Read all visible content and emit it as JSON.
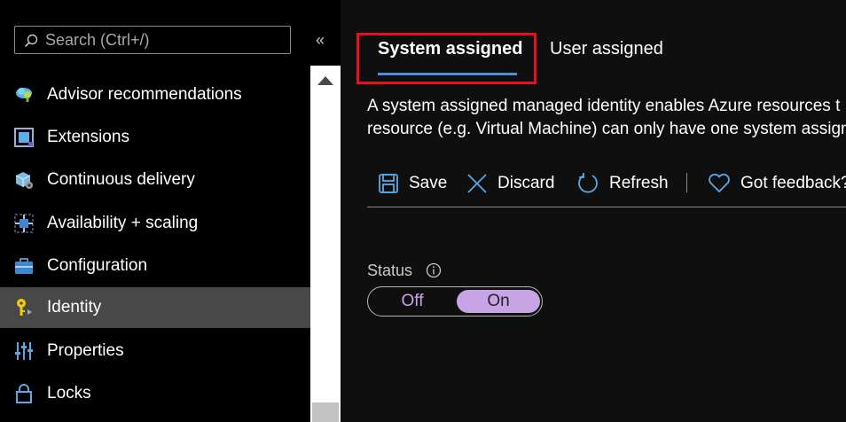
{
  "search": {
    "placeholder": "Search (Ctrl+/)"
  },
  "sidebar": {
    "collapse_glyph": "«",
    "items": [
      {
        "label": "Advisor recommendations",
        "icon": "advisor-cloud-icon",
        "active": false
      },
      {
        "label": "Extensions",
        "icon": "extensions-icon",
        "active": false
      },
      {
        "label": "Continuous delivery",
        "icon": "continuous-delivery-icon",
        "active": false
      },
      {
        "label": "Availability + scaling",
        "icon": "availability-scaling-icon",
        "active": false
      },
      {
        "label": "Configuration",
        "icon": "configuration-icon",
        "active": false
      },
      {
        "label": "Identity",
        "icon": "identity-key-icon",
        "active": true
      },
      {
        "label": "Properties",
        "icon": "properties-icon",
        "active": false
      },
      {
        "label": "Locks",
        "icon": "lock-icon",
        "active": false
      }
    ]
  },
  "tabs": [
    {
      "label": "System assigned",
      "selected": true
    },
    {
      "label": "User assigned",
      "selected": false
    }
  ],
  "description": {
    "line1": "A system assigned managed identity enables Azure resources t",
    "line2": "resource (e.g. Virtual Machine) can only have one system assign"
  },
  "toolbar": {
    "save_label": "Save",
    "discard_label": "Discard",
    "refresh_label": "Refresh",
    "feedback_label": "Got feedback?"
  },
  "status": {
    "label": "Status",
    "off_label": "Off",
    "on_label": "On",
    "value": "On"
  },
  "colors": {
    "accent": "#4f8fd6",
    "highlight": "#e8101a",
    "toggle_on": "#c8a4e6",
    "active_row": "#484848"
  }
}
